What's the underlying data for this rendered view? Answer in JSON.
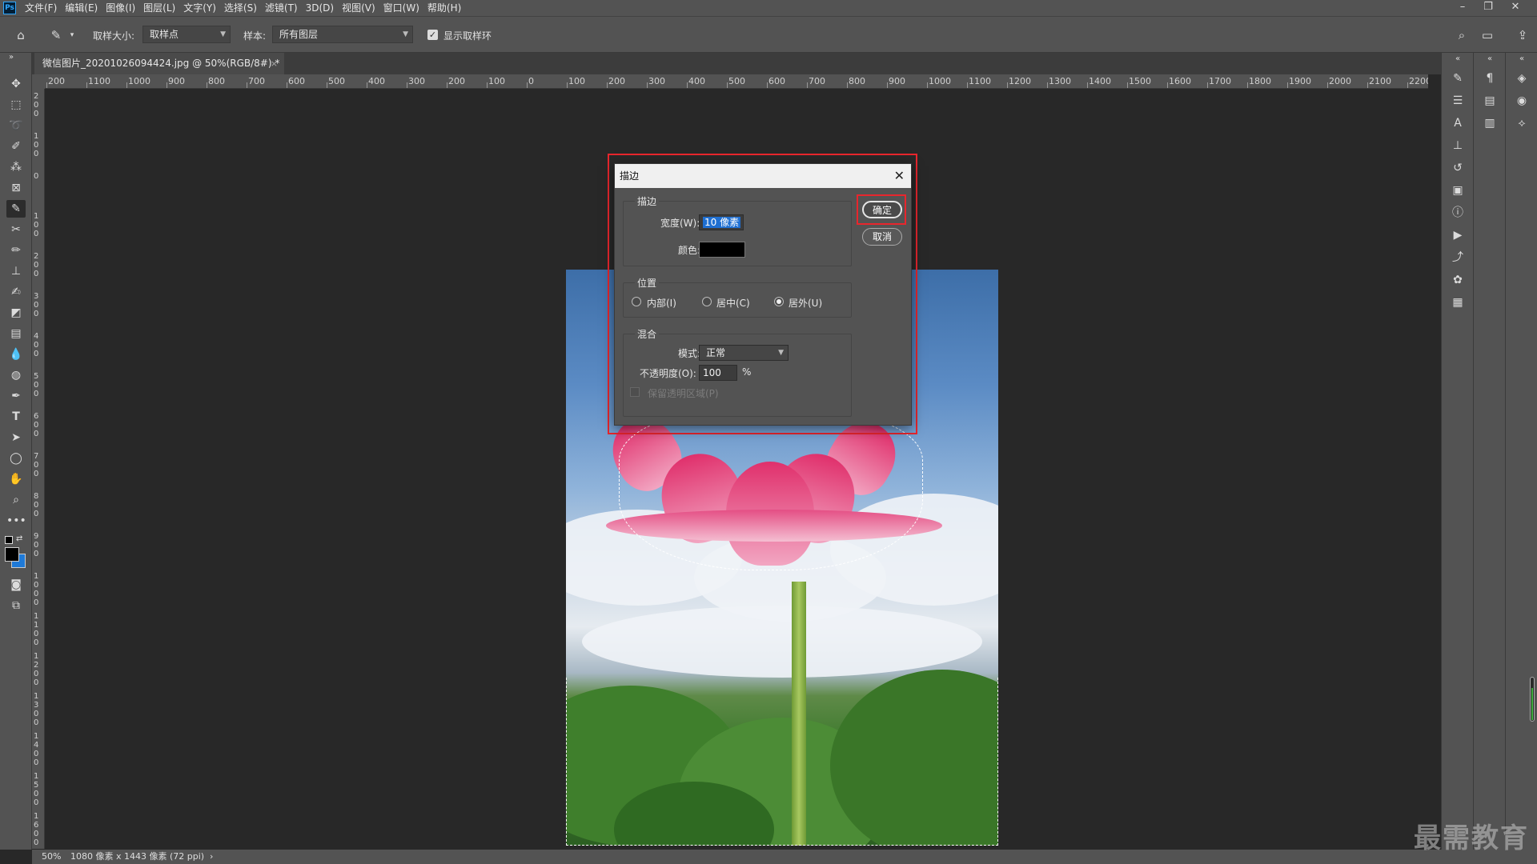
{
  "app": {
    "logo": "Ps"
  },
  "menu": [
    "文件(F)",
    "编辑(E)",
    "图像(I)",
    "图层(L)",
    "文字(Y)",
    "选择(S)",
    "滤镜(T)",
    "3D(D)",
    "视图(V)",
    "窗口(W)",
    "帮助(H)"
  ],
  "options": {
    "sample_size_label": "取样大小:",
    "sample_size_value": "取样点",
    "sample_label": "样本:",
    "sample_value": "所有图层",
    "show_ring_label": "显示取样环",
    "show_ring_checked": true
  },
  "tab": {
    "title": "微信图片_20201026094424.jpg @ 50%(RGB/8#) *",
    "close": "×"
  },
  "ruler_h": [
    "200",
    "1100",
    "1000",
    "900",
    "800",
    "700",
    "600",
    "500",
    "400",
    "300",
    "200",
    "100",
    "0",
    "100",
    "200",
    "300",
    "400",
    "500",
    "600",
    "700",
    "800",
    "900",
    "1000",
    "1100",
    "1200",
    "1300",
    "1400",
    "1500",
    "1600",
    "1700",
    "1800",
    "1900",
    "2000",
    "2100",
    "2200"
  ],
  "ruler_v": [
    "200",
    "100",
    "0",
    "100",
    "200",
    "300",
    "400",
    "500",
    "600",
    "700",
    "800",
    "900",
    "1000",
    "1100",
    "1200",
    "1300",
    "1400",
    "1500",
    "1600"
  ],
  "dialog": {
    "title": "描边",
    "close": "✕",
    "stroke_group": "描边",
    "width_label": "宽度(W):",
    "width_value": "10 像素",
    "color_label": "颜色:",
    "color_value": "#000000",
    "position_group": "位置",
    "pos_inside": "内部(I)",
    "pos_center": "居中(C)",
    "pos_outside": "居外(U)",
    "pos_selected": "outside",
    "blend_group": "混合",
    "mode_label": "模式:",
    "mode_value": "正常",
    "opacity_label": "不透明度(O):",
    "opacity_value": "100",
    "opacity_unit": "%",
    "preserve_label": "保留透明区域(P)",
    "ok": "确定",
    "cancel": "取消"
  },
  "status": {
    "zoom": "50%",
    "info": "1080 像素 x 1443 像素 (72 ppi)",
    "arrow": "›"
  },
  "watermark": "最需教育",
  "colors": {
    "highlight": "#e8262d",
    "accent": "#1f6fd1"
  }
}
